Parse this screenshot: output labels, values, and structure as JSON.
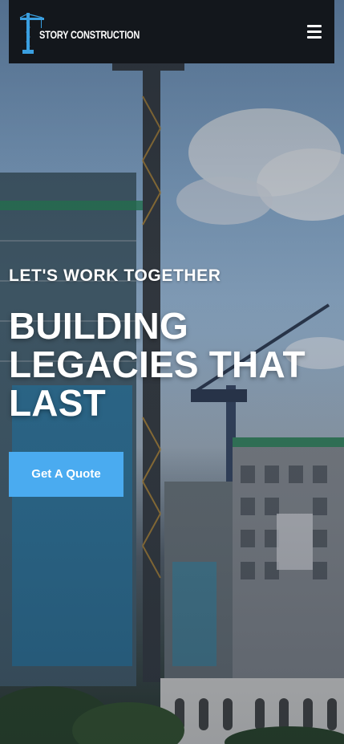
{
  "header": {
    "logo_text": "STORY CONSTRUCTION",
    "logo_icon": "crane-icon",
    "menu_icon": "hamburger-menu-icon",
    "background_color": "#13171c"
  },
  "hero": {
    "eyebrow": "LET'S WORK TOGETHER",
    "headline_lines": [
      "BUILDING",
      "LEGACIES THAT",
      "LAST"
    ],
    "cta_label": "Get A Quote",
    "cta_color": "#4aabf0"
  },
  "colors": {
    "accent": "#4aabf0",
    "text": "#ffffff",
    "logo_blue": "#3a9fe0"
  }
}
